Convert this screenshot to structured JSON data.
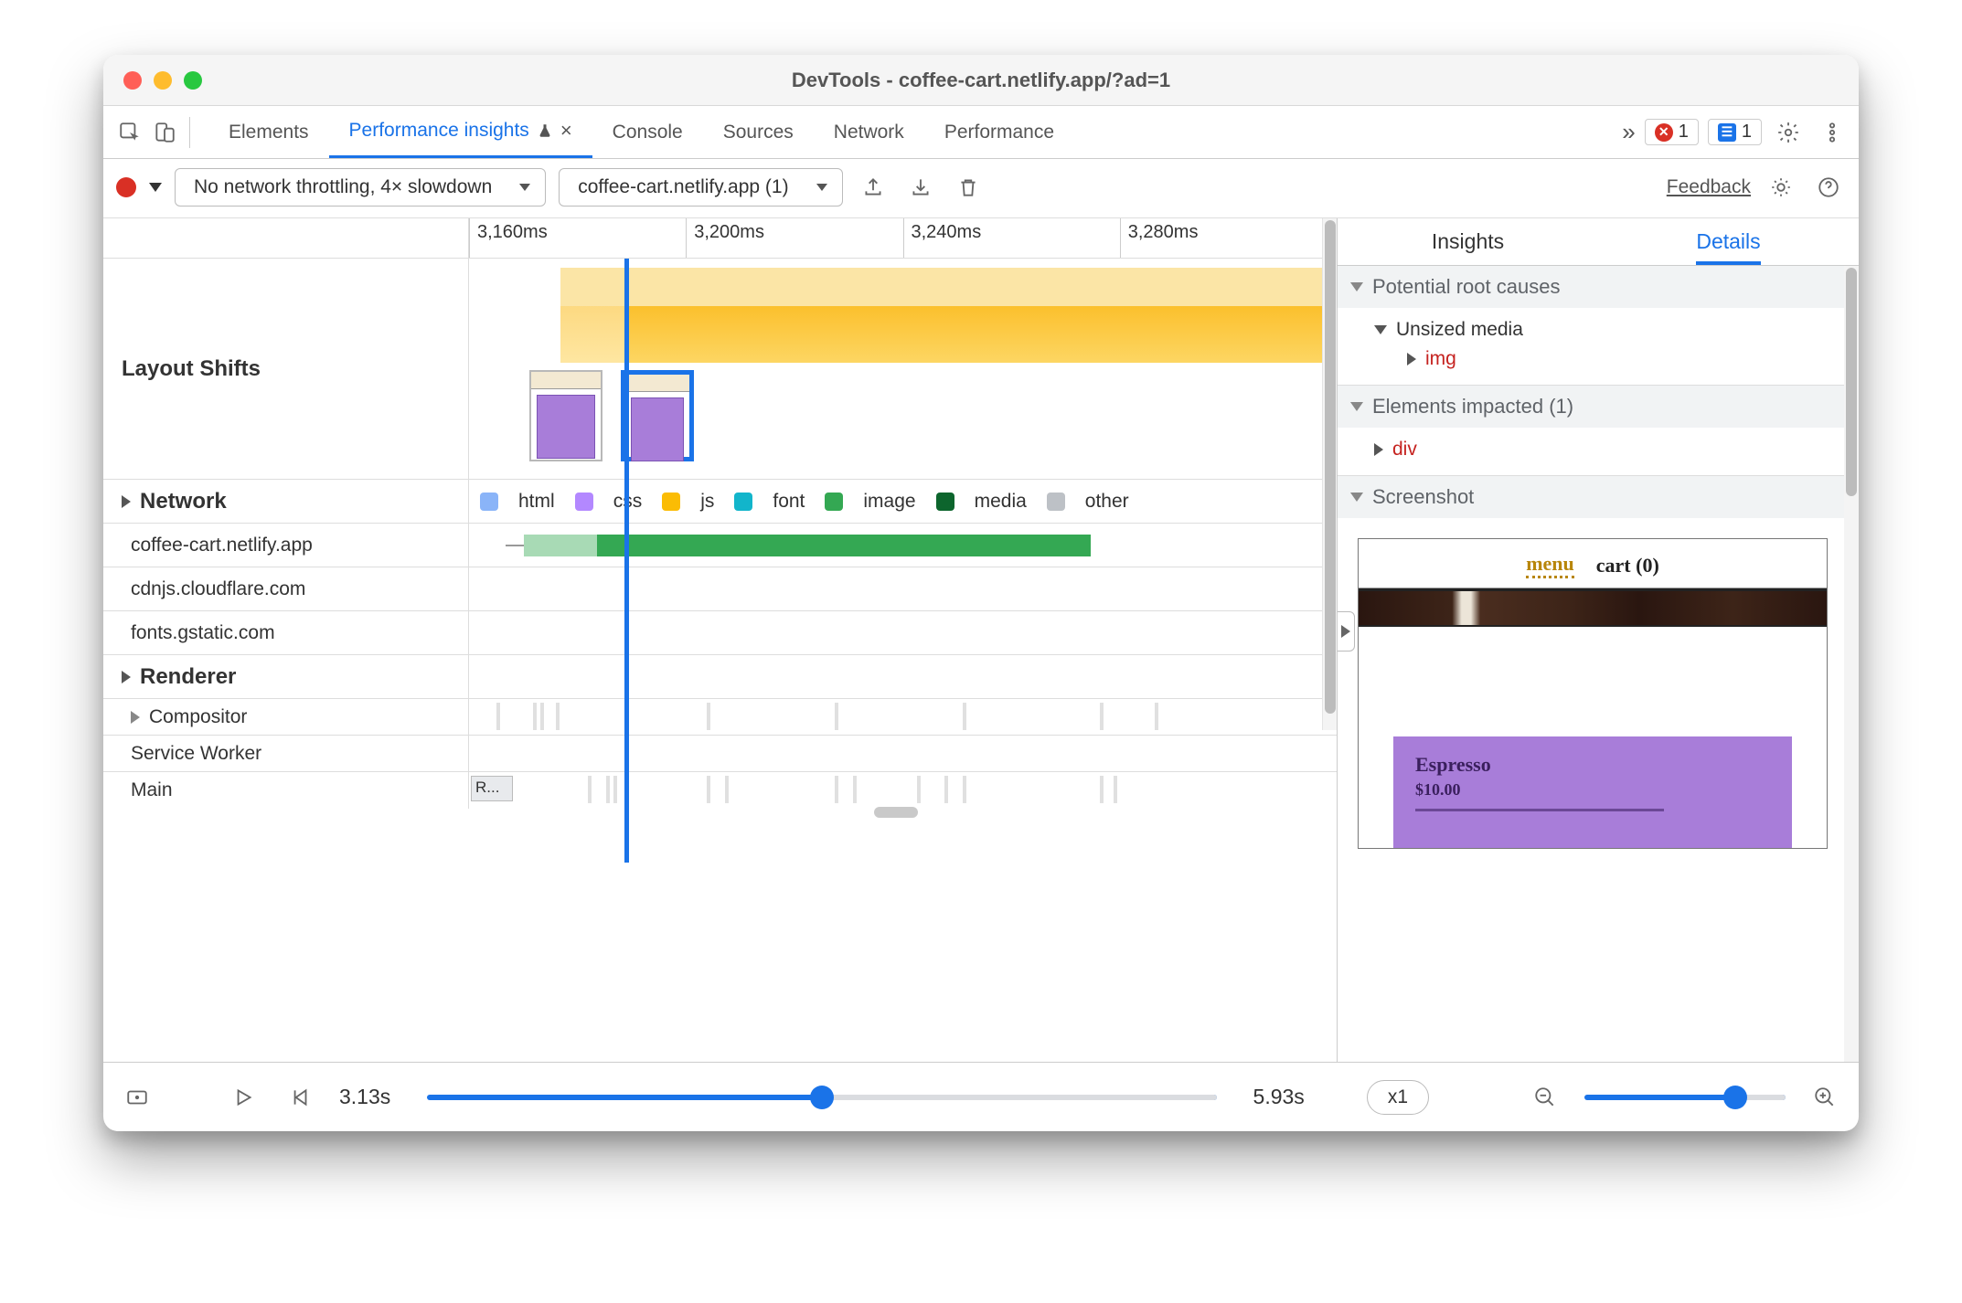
{
  "window": {
    "title": "DevTools - coffee-cart.netlify.app/?ad=1"
  },
  "tabs": {
    "list": [
      "Elements",
      "Performance insights",
      "Console",
      "Sources",
      "Network",
      "Performance"
    ],
    "active_index": 1,
    "errors": "1",
    "infos": "1"
  },
  "toolbar": {
    "throttling": "No network throttling, 4× slowdown",
    "page": "coffee-cart.netlify.app (1)",
    "feedback": "Feedback"
  },
  "ruler": [
    "3,160ms",
    "3,200ms",
    "3,240ms",
    "3,280ms"
  ],
  "timeline": {
    "layout_shifts": "Layout Shifts",
    "network": "Network",
    "hosts": [
      "coffee-cart.netlify.app",
      "cdnjs.cloudflare.com",
      "fonts.gstatic.com"
    ],
    "renderer": "Renderer",
    "compositor": "Compositor",
    "service_worker": "Service Worker",
    "main": "Main",
    "main_block": "R...",
    "legend": {
      "html": "html",
      "css": "css",
      "js": "js",
      "font": "font",
      "image": "image",
      "media": "media",
      "other": "other"
    }
  },
  "details": {
    "tabs": {
      "insights": "Insights",
      "details": "Details"
    },
    "root_causes": "Potential root causes",
    "unsized": "Unsized media",
    "img_tag": "img",
    "impacted": "Elements impacted (1)",
    "div_tag": "div",
    "screenshot": "Screenshot",
    "product": {
      "name": "Espresso",
      "price": "$10.00"
    },
    "nav": {
      "menu": "menu",
      "cart": "cart (0)"
    }
  },
  "footer": {
    "start": "3.13s",
    "end": "5.93s",
    "speed": "x1"
  }
}
